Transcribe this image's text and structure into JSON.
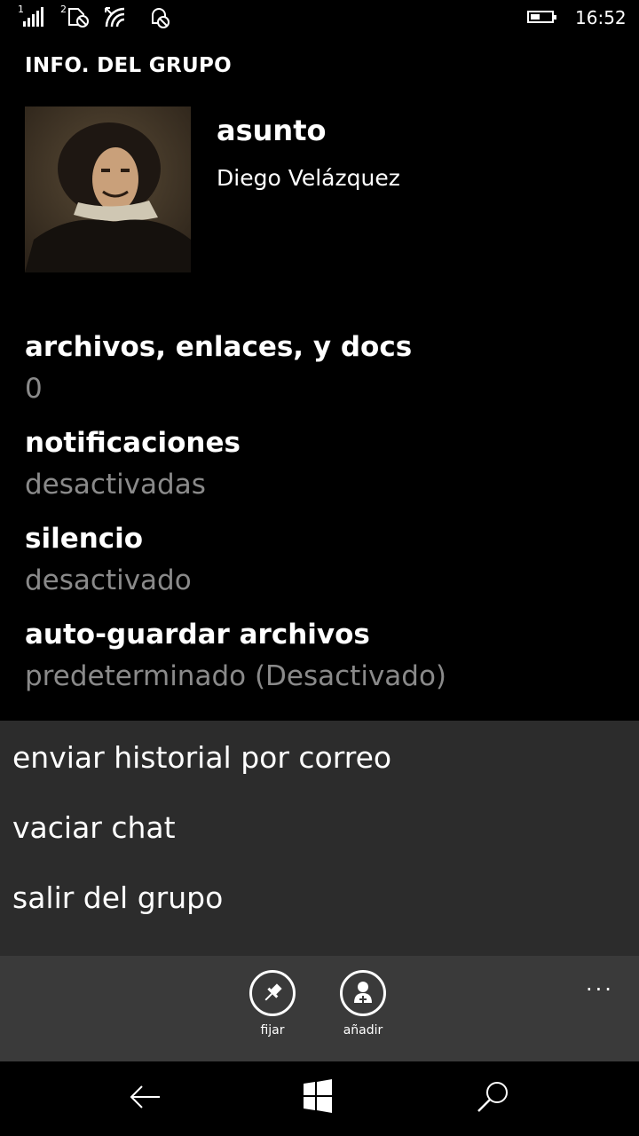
{
  "status_bar": {
    "sim1": "1",
    "sim2": "2",
    "time": "16:52",
    "icons": [
      "signal-icon",
      "sim2-no-signal-icon",
      "wifi-icon",
      "do-not-disturb-icon",
      "battery-icon"
    ]
  },
  "header": {
    "title": "INFO. DEL GRUPO"
  },
  "group": {
    "subject": "asunto",
    "member": "Diego Velázquez"
  },
  "settings": [
    {
      "label": "archivos, enlaces, y docs",
      "value": "0"
    },
    {
      "label": "notificaciones",
      "value": "desactivadas"
    },
    {
      "label": "silencio",
      "value": "desactivado"
    },
    {
      "label": "auto-guardar archivos",
      "value": "predeterminado (Desactivado)"
    }
  ],
  "menu": {
    "items": [
      "enviar historial por correo",
      "vaciar chat",
      "salir del grupo"
    ]
  },
  "app_bar": {
    "pin_label": "fijar",
    "add_label": "añadir",
    "more": "···"
  },
  "nav_bar": {
    "icons": [
      "back-icon",
      "windows-icon",
      "search-icon"
    ]
  }
}
